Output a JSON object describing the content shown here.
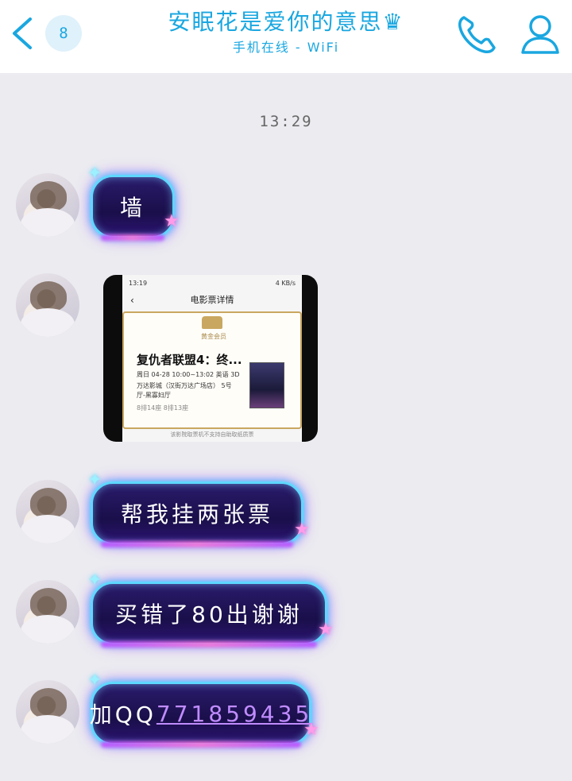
{
  "header": {
    "unread_count": "8",
    "title": "安眠花是爱你的意思♛",
    "status": "手机在线 - WiFi"
  },
  "timestamp": "13:29",
  "messages": [
    {
      "text": "墙"
    },
    {
      "image": {
        "status_time": "13:19",
        "status_speed": "4 KB/s",
        "nav_title": "电影票详情",
        "badge": "黄金会员",
        "movie_title": "复仇者联盟4：终...",
        "showtime": "周日 04-28 10:00~13:02 英语 3D",
        "cinema": "万达影城（汉街万达广场店） 5号",
        "hall": "厅-黑寡妇厅",
        "seats": "8排14座 8排13座",
        "footer": "该影院取票机不支持自助取纸质票"
      }
    },
    {
      "text": "帮我挂两张票"
    },
    {
      "text": "买错了80出谢谢"
    },
    {
      "text_prefix": "加QQ",
      "link": "771859435"
    }
  ],
  "colors": {
    "accent": "#1aa7e0",
    "bubble_border": "#5ed7ff",
    "bubble_fill": "#1a0f4a",
    "link": "#c08cff"
  },
  "icons": {
    "back": "chevron-left-icon",
    "call": "phone-icon",
    "profile": "user-icon"
  }
}
